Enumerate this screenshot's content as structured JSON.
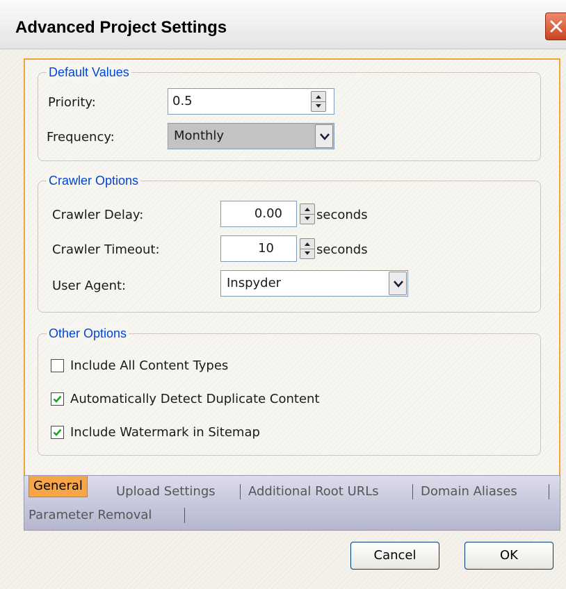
{
  "window": {
    "title": "Advanced Project Settings"
  },
  "default_values": {
    "legend": "Default Values",
    "priority_label": "Priority:",
    "priority_value": "0.5",
    "frequency_label": "Frequency:",
    "frequency_value": "Monthly"
  },
  "crawler_options": {
    "legend": "Crawler Options",
    "delay_label": "Crawler Delay:",
    "delay_value": "0.00",
    "delay_unit": "seconds",
    "timeout_label": "Crawler Timeout:",
    "timeout_value": "10",
    "timeout_unit": "seconds",
    "user_agent_label": "User Agent:",
    "user_agent_value": "Inspyder"
  },
  "other_options": {
    "legend": "Other Options",
    "items": [
      {
        "label": "Include All Content Types",
        "checked": false
      },
      {
        "label": "Automatically Detect Duplicate Content",
        "checked": true
      },
      {
        "label": "Include Watermark in Sitemap",
        "checked": true
      }
    ]
  },
  "tabs": [
    {
      "label": "General",
      "active": true
    },
    {
      "label": "Upload Settings",
      "active": false
    },
    {
      "label": "Additional Root URLs",
      "active": false
    },
    {
      "label": "Domain Aliases",
      "active": false
    },
    {
      "label": "Parameter Removal",
      "active": false
    }
  ],
  "buttons": {
    "cancel": "Cancel",
    "ok": "OK"
  },
  "colors": {
    "legend": "#0046d5",
    "active_tab": "#f6a548",
    "panel_border": "#f0a236",
    "check": "#21a121"
  }
}
